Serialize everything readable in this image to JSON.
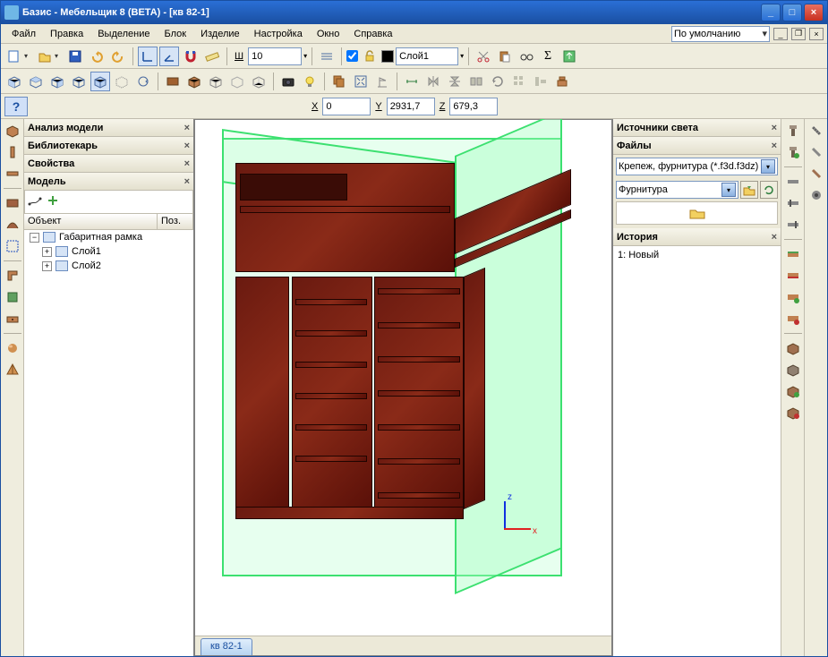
{
  "window": {
    "title": "Базис - Мебельщик 8 (BETA) - [кв 82-1]"
  },
  "menu": {
    "file": "Файл",
    "edit": "Правка",
    "select": "Выделение",
    "block": "Блок",
    "product": "Изделие",
    "settings": "Настройка",
    "window": "Окно",
    "help": "Справка",
    "preset": "По умолчанию"
  },
  "toolbar1": {
    "width_label": "Ш",
    "width_value": "10",
    "layer_label": "Слой1"
  },
  "coords": {
    "x_label": "X",
    "x_value": "0",
    "y_label": "Y",
    "y_value": "2931,7",
    "z_label": "Z",
    "z_value": "679,3"
  },
  "panels": {
    "analysis": "Анализ модели",
    "librarian": "Библиотекарь",
    "properties": "Свойства",
    "model": "Модель",
    "object_col": "Объект",
    "pos_col": "Поз.",
    "tree": {
      "root": "Габаритная рамка",
      "layer1": "Слой1",
      "layer2": "Слой2"
    },
    "lights": "Источники света",
    "files": "Файлы",
    "fastener_filter": "Крепеж, фурнитура (*.f3d.f3dz)",
    "furniture": "Фурнитура",
    "history": "История",
    "history_item": "1: Новый"
  },
  "tab": {
    "doc": "кв 82-1"
  },
  "axis": {
    "x": "x",
    "z": "z"
  }
}
